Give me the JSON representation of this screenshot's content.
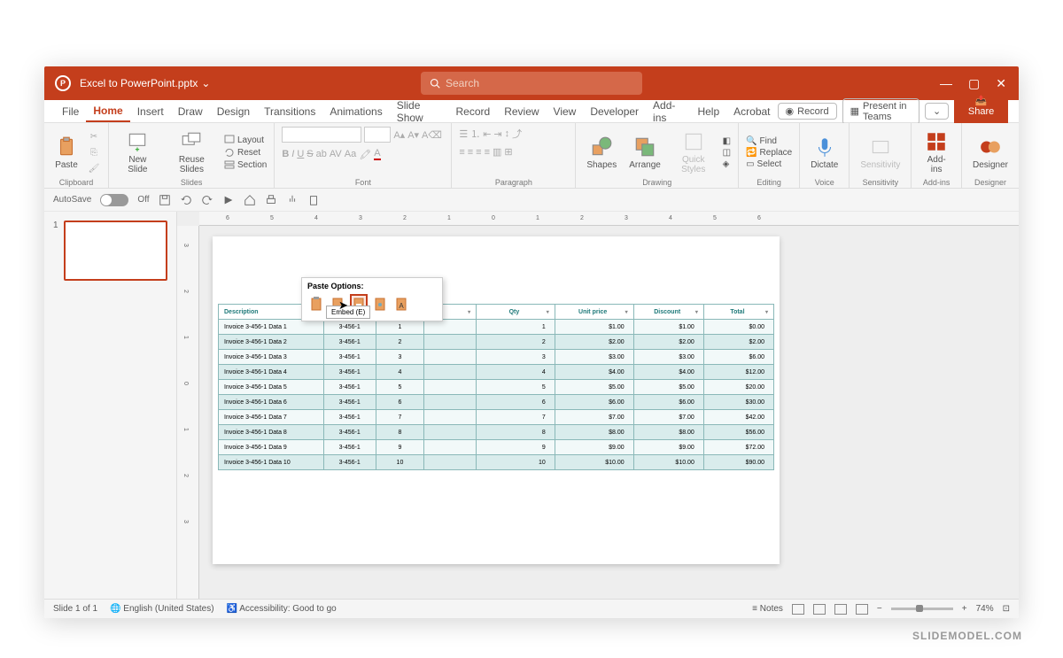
{
  "titlebar": {
    "filename": "Excel to PowerPoint.pptx",
    "chevron": "⌄",
    "search_placeholder": "Search"
  },
  "tabs": {
    "items": [
      "File",
      "Home",
      "Insert",
      "Draw",
      "Design",
      "Transitions",
      "Animations",
      "Slide Show",
      "Record",
      "Review",
      "View",
      "Developer",
      "Add-ins",
      "Help",
      "Acrobat"
    ],
    "active": "Home",
    "record": "Record",
    "present": "Present in Teams",
    "share": "Share"
  },
  "ribbon": {
    "clipboard": {
      "label": "Clipboard",
      "paste": "Paste"
    },
    "slides": {
      "label": "Slides",
      "new": "New Slide",
      "reuse": "Reuse Slides",
      "layout": "Layout",
      "reset": "Reset",
      "section": "Section"
    },
    "font": {
      "label": "Font"
    },
    "paragraph": {
      "label": "Paragraph"
    },
    "drawing": {
      "label": "Drawing",
      "shapes": "Shapes",
      "arrange": "Arrange",
      "quick": "Quick Styles"
    },
    "editing": {
      "label": "Editing",
      "find": "Find",
      "replace": "Replace",
      "select": "Select"
    },
    "voice": {
      "label": "Voice",
      "dictate": "Dictate"
    },
    "sensitivity": {
      "label": "Sensitivity",
      "btn": "Sensitivity"
    },
    "addins": {
      "label": "Add-ins",
      "btn": "Add-ins"
    },
    "designer": {
      "label": "Designer",
      "btn": "Designer"
    }
  },
  "qat": {
    "autosave": "AutoSave",
    "off": "Off"
  },
  "ruler": {
    "marks": [
      "6",
      "5",
      "4",
      "3",
      "2",
      "1",
      "0",
      "1",
      "2",
      "3",
      "4",
      "5",
      "6"
    ],
    "v": [
      "3",
      "2",
      "1",
      "0",
      "1",
      "2",
      "3"
    ]
  },
  "table": {
    "headers": [
      "Description",
      "",
      "",
      "",
      "Qty",
      "Unit price",
      "Discount",
      "Total"
    ],
    "rows": [
      [
        "Invoice 3-456-1 Data 1",
        "3-456-1",
        "1",
        "1",
        "$1.00",
        "$1.00",
        "$0.00"
      ],
      [
        "Invoice 3-456-1 Data 2",
        "3-456-1",
        "2",
        "2",
        "$2.00",
        "$2.00",
        "$2.00"
      ],
      [
        "Invoice 3-456-1 Data 3",
        "3-456-1",
        "3",
        "3",
        "$3.00",
        "$3.00",
        "$6.00"
      ],
      [
        "Invoice 3-456-1 Data 4",
        "3-456-1",
        "4",
        "4",
        "$4.00",
        "$4.00",
        "$12.00"
      ],
      [
        "Invoice 3-456-1 Data 5",
        "3-456-1",
        "5",
        "5",
        "$5.00",
        "$5.00",
        "$20.00"
      ],
      [
        "Invoice 3-456-1 Data 6",
        "3-456-1",
        "6",
        "6",
        "$6.00",
        "$6.00",
        "$30.00"
      ],
      [
        "Invoice 3-456-1 Data 7",
        "3-456-1",
        "7",
        "7",
        "$7.00",
        "$7.00",
        "$42.00"
      ],
      [
        "Invoice 3-456-1 Data 8",
        "3-456-1",
        "8",
        "8",
        "$8.00",
        "$8.00",
        "$56.00"
      ],
      [
        "Invoice 3-456-1 Data 9",
        "3-456-1",
        "9",
        "9",
        "$9.00",
        "$9.00",
        "$72.00"
      ],
      [
        "Invoice 3-456-1 Data 10",
        "3-456-1",
        "10",
        "10",
        "$10.00",
        "$10.00",
        "$90.00"
      ]
    ]
  },
  "paste_popup": {
    "title": "Paste Options:",
    "tooltip": "Embed (E)"
  },
  "status": {
    "slide": "Slide 1 of 1",
    "lang": "English (United States)",
    "access": "Accessibility: Good to go",
    "notes": "Notes",
    "zoom": "74%"
  },
  "thumb": {
    "num": "1"
  },
  "watermark": "SLIDEMODEL.COM"
}
